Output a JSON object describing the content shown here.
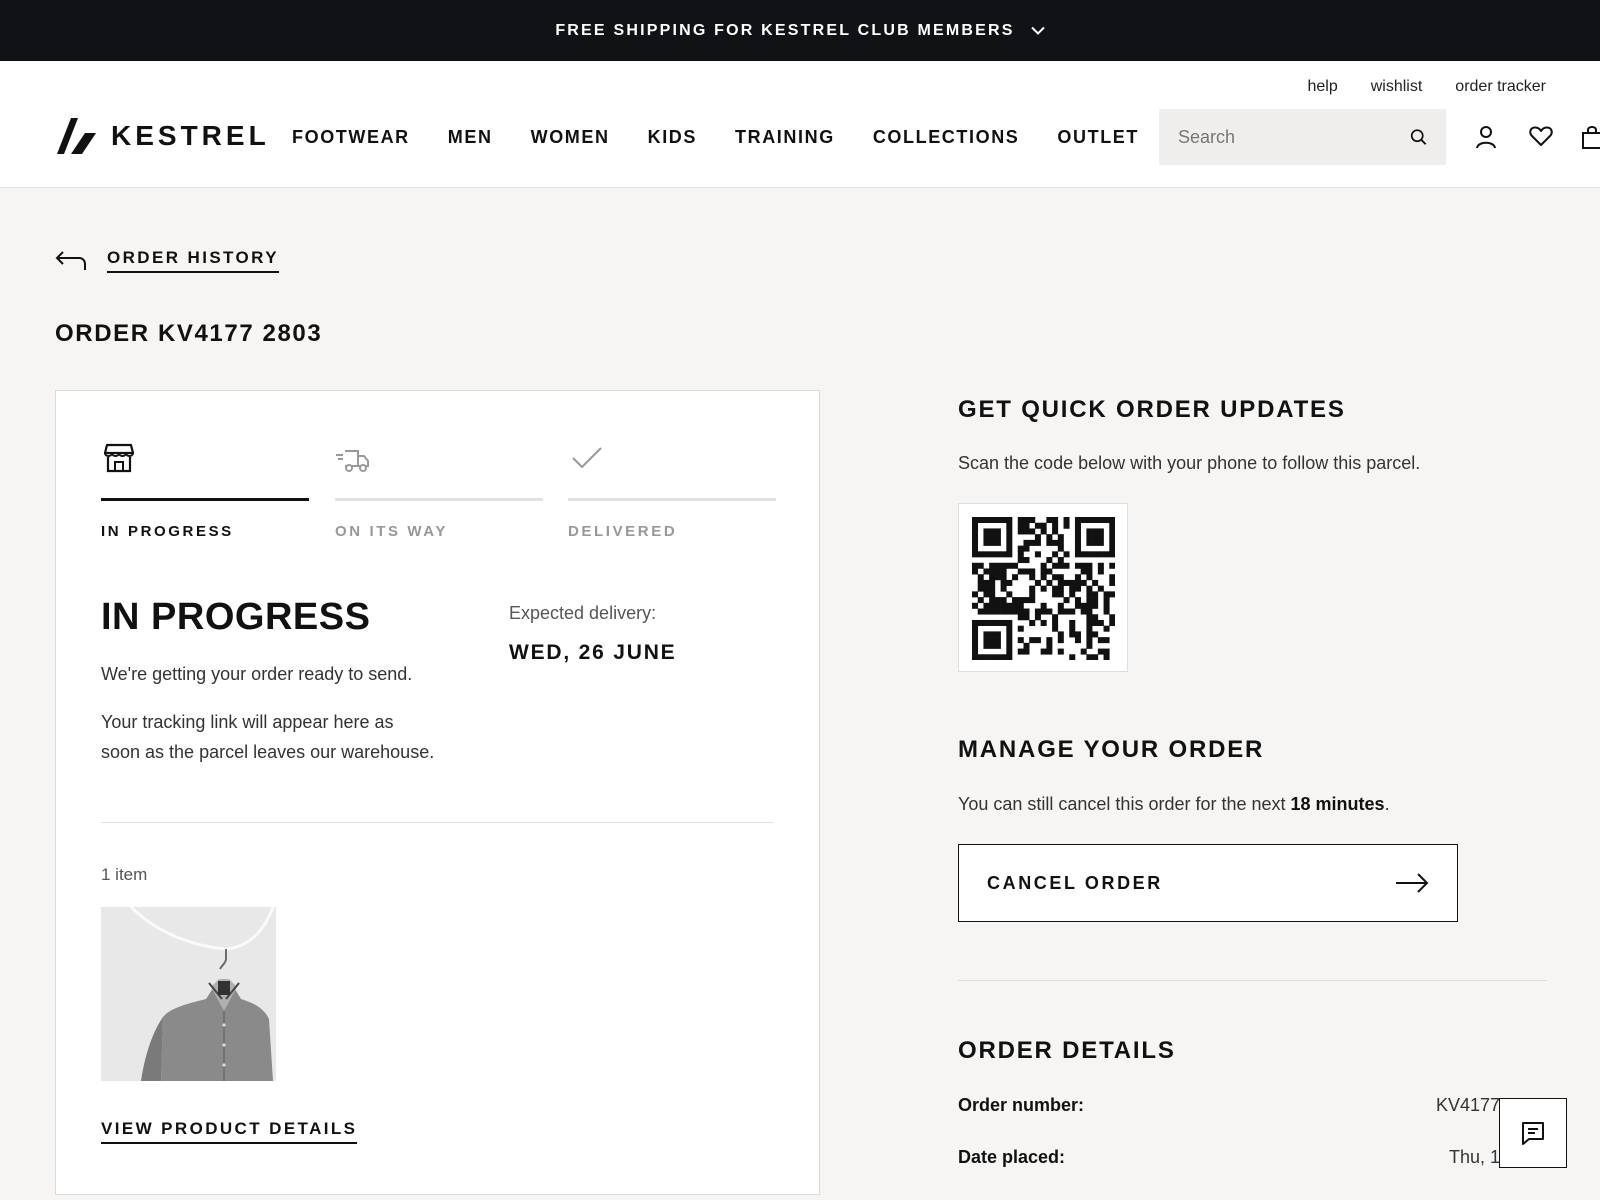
{
  "promo": {
    "text": "FREE SHIPPING FOR KESTREL CLUB MEMBERS",
    "icon": "chevron-down-icon"
  },
  "header": {
    "utility_links": [
      "help",
      "wishlist",
      "order tracker"
    ],
    "logo_text": "KESTREL",
    "nav": [
      "FOOTWEAR",
      "MEN",
      "WOMEN",
      "KIDS",
      "TRAINING",
      "COLLECTIONS",
      "OUTLET"
    ],
    "search_placeholder": "Search",
    "icons": [
      "search-icon",
      "account-icon",
      "heart-icon",
      "bag-icon"
    ]
  },
  "breadcrumb": {
    "label": "ORDER HISTORY"
  },
  "order": {
    "title": "ORDER KV4177 2803",
    "steps": [
      {
        "label": "IN PROGRESS",
        "icon": "store-icon",
        "active": true
      },
      {
        "label": "ON ITS WAY",
        "icon": "truck-icon",
        "active": false
      },
      {
        "label": "DELIVERED",
        "icon": "check-icon",
        "active": false
      }
    ],
    "status_heading": "IN PROGRESS",
    "status_text": "We're getting your order ready to send.",
    "tracking_line1": "Your tracking link will appear here as",
    "tracking_line2": "soon as the parcel leaves our warehouse.",
    "expected_label": "Expected delivery:",
    "expected_date": "WED, 26 JUNE",
    "items_count": "1 item",
    "view_details": "VIEW PRODUCT DETAILS"
  },
  "updates": {
    "heading": "GET QUICK ORDER UPDATES",
    "text": "Scan the code below with your phone to follow this parcel."
  },
  "manage": {
    "heading": "MANAGE YOUR ORDER",
    "text_before": "You can still cancel this order for the next ",
    "time": "18 minutes",
    "text_after": ".",
    "cancel_label": "CANCEL ORDER"
  },
  "details": {
    "heading": "ORDER DETAILS",
    "rows": [
      {
        "label": "Order number:",
        "value": "KV4177"
      },
      {
        "label": "Date placed:",
        "value": "Thu, 1"
      }
    ]
  },
  "colors": {
    "promo_bg": "#111215",
    "page_bg": "#f6f5f4",
    "accent": "#111111"
  }
}
